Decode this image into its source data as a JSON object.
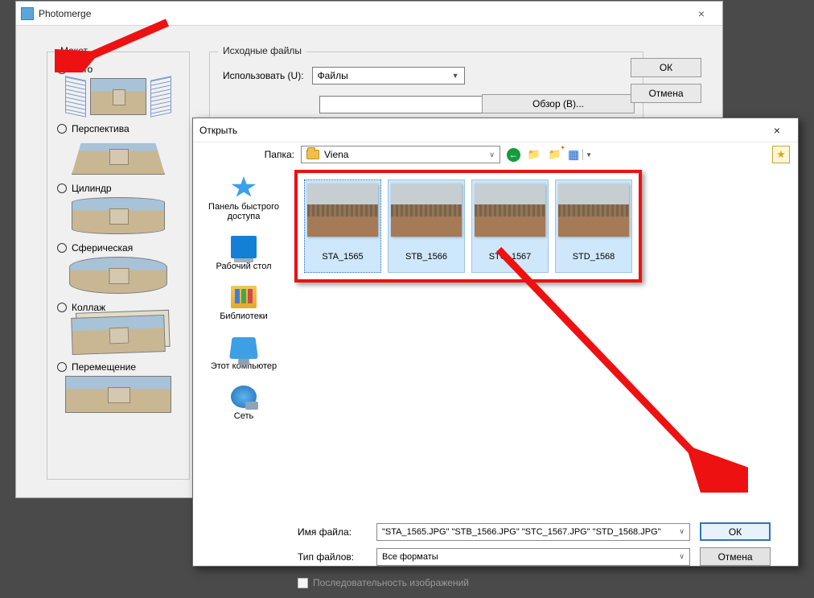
{
  "photomerge": {
    "title": "Photomerge",
    "ok_label": "ОК",
    "cancel_label": "Отмена",
    "layout": {
      "legend": "Макет",
      "auto": "Авто",
      "perspective": "Перспектива",
      "cylinder": "Цилиндр",
      "spherical": "Сферическая",
      "collage": "Коллаж",
      "reposition": "Перемещение",
      "selected": "auto"
    },
    "source": {
      "legend": "Исходные файлы",
      "use_label": "Использовать (U):",
      "use_value": "Файлы",
      "browse_label": "Обзор (B)..."
    }
  },
  "open": {
    "title": "Открыть",
    "folder_label": "Папка:",
    "folder_value": "Viena",
    "sidebar": {
      "quick": "Панель быстрого доступа",
      "desktop": "Рабочий стол",
      "libraries": "Библиотеки",
      "thispc": "Этот компьютер",
      "network": "Сеть"
    },
    "thumbs": [
      "STA_1565",
      "STB_1566",
      "STC_1567",
      "STD_1568"
    ],
    "filename_label": "Имя файла:",
    "filename_value": "\"STA_1565.JPG\" \"STB_1566.JPG\" \"STC_1567.JPG\" \"STD_1568.JPG\"",
    "filetype_label": "Тип файлов:",
    "filetype_value": "Все форматы",
    "ok_label": "ОК",
    "cancel_label": "Отмена",
    "sequence_label": "Последовательность изображений"
  }
}
